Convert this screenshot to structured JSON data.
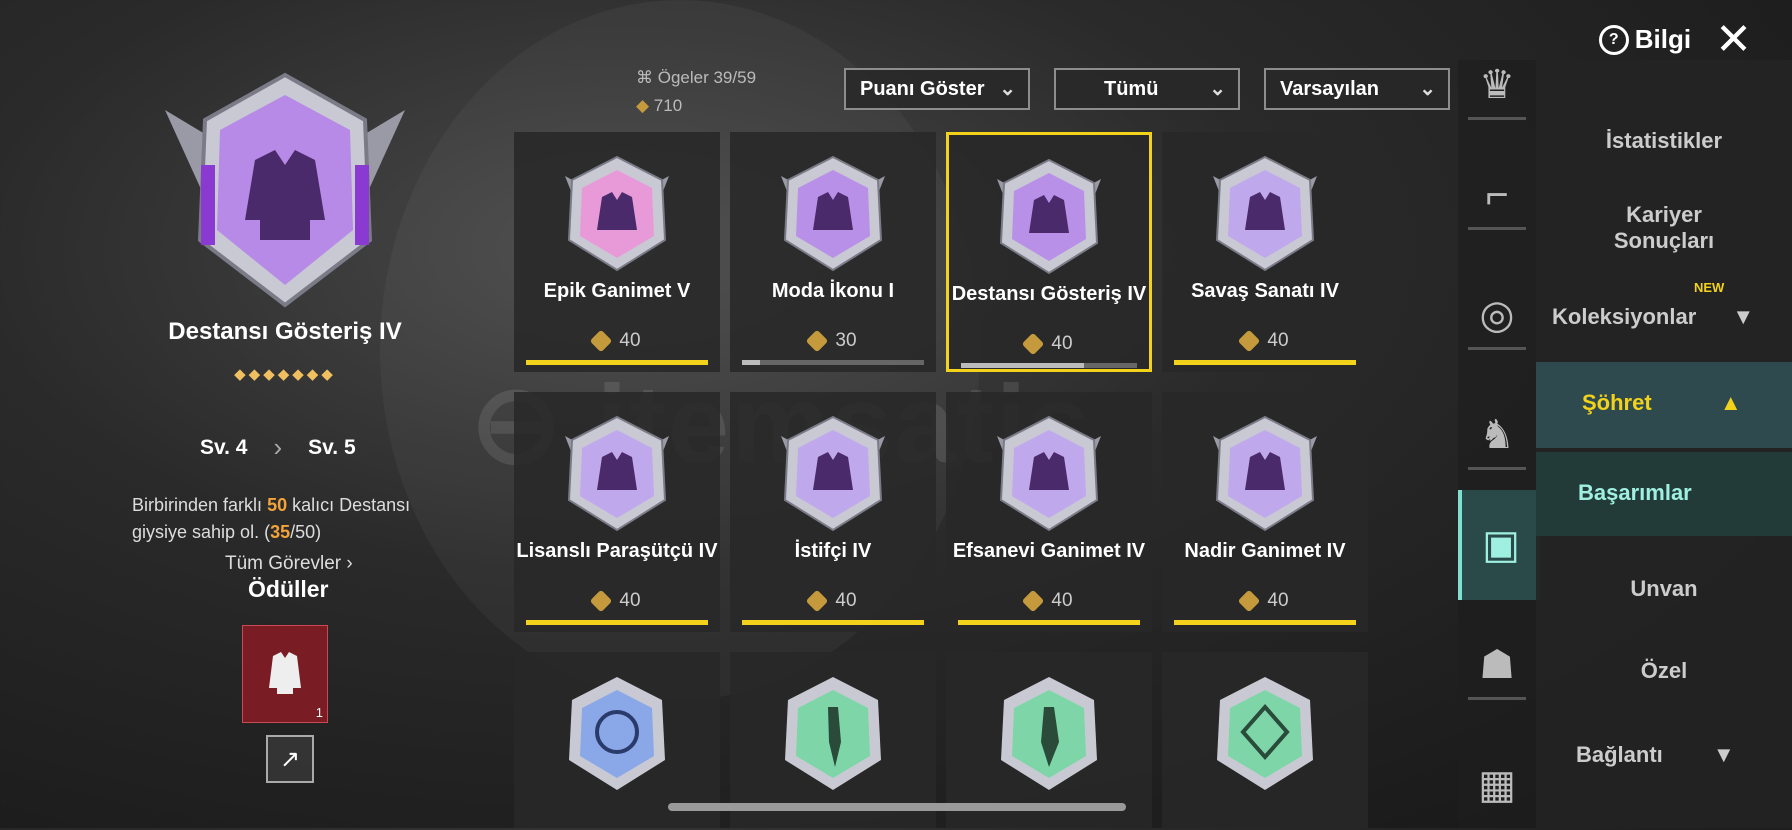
{
  "header": {
    "info_label": "Bilgi"
  },
  "selected": {
    "title": "Destansı Gösteriş IV",
    "stars": "◆◆◆◆◆◆◆",
    "level_from": "Sv. 4",
    "level_to": "Sv. 5",
    "desc_pre": "Birbirinden farklı ",
    "desc_num": "50",
    "desc_mid": " kalıcı Destansı giysiye sahip ol. (",
    "desc_prog": "35",
    "desc_post": "/50)",
    "all_tasks": "Tüm Görevler",
    "rewards_title": "Ödüller",
    "reward_count": "1"
  },
  "stats": {
    "items": "Ögeler  39/59",
    "points": "710"
  },
  "filters": {
    "points": "Puanı Göster",
    "all": "Tümü",
    "sort": "Varsayılan"
  },
  "cards": [
    {
      "name": "Epik Ganimet V",
      "pts": "40",
      "progress": 1.0
    },
    {
      "name": "Moda İkonu I",
      "pts": "30",
      "progress": 0.1
    },
    {
      "name": "Destansı Gösteriş IV",
      "pts": "40",
      "progress": 0.7
    },
    {
      "name": "Savaş Sanatı IV",
      "pts": "40",
      "progress": 1.0
    },
    {
      "name": "Lisanslı Paraşütçü IV",
      "pts": "40",
      "progress": 1.0
    },
    {
      "name": "İstifçi IV",
      "pts": "40",
      "progress": 1.0
    },
    {
      "name": "Efsanevi Ganimet IV",
      "pts": "40",
      "progress": 1.0
    },
    {
      "name": "Nadir Ganimet IV",
      "pts": "40",
      "progress": 1.0
    }
  ],
  "menu": {
    "istatistikler": "İstatistikler",
    "kariyer1": "Kariyer",
    "kariyer2": "Sonuçları",
    "koleksiyonlar": "Koleksiyonlar",
    "new_tag": "NEW",
    "sohret": "Şöhret",
    "basarimlar": "Başarımlar",
    "unvan": "Unvan",
    "ozel": "Özel",
    "baglanti": "Bağlantı"
  },
  "colors": {
    "accent_yellow": "#f2d21a",
    "accent_cyan": "#9ff0e0",
    "purple_badge": "#a87ad8"
  }
}
